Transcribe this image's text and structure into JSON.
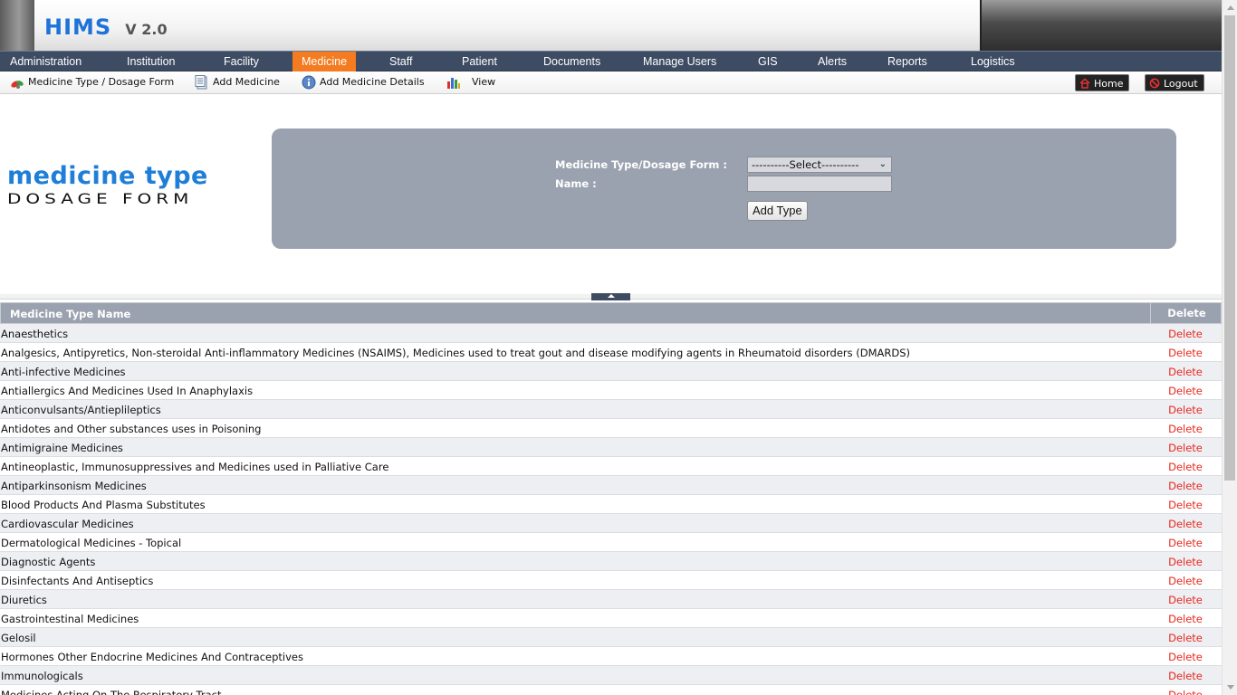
{
  "app": {
    "logo": "HIMS",
    "version": "V 2.0"
  },
  "top_nav": [
    {
      "label": "Administration",
      "active": false
    },
    {
      "label": "Institution",
      "active": false
    },
    {
      "label": "Facility",
      "active": false
    },
    {
      "label": "Medicine",
      "active": true
    },
    {
      "label": "Staff",
      "active": false
    },
    {
      "label": "Patient",
      "active": false
    },
    {
      "label": "Documents",
      "active": false
    },
    {
      "label": "Manage Users",
      "active": false
    },
    {
      "label": "GIS",
      "active": false
    },
    {
      "label": "Alerts",
      "active": false
    },
    {
      "label": "Reports",
      "active": false
    },
    {
      "label": "Logistics",
      "active": false
    }
  ],
  "sub_nav": [
    {
      "label": "Medicine Type / Dosage Form",
      "icon": "pills-icon"
    },
    {
      "label": "Add Medicine",
      "icon": "document-icon"
    },
    {
      "label": "Add Medicine Details",
      "icon": "info-icon"
    },
    {
      "label": "View",
      "icon": "bar-chart-icon"
    }
  ],
  "actions": {
    "home": "Home",
    "logout": "Logout"
  },
  "page_title": {
    "line1": "medicine type",
    "line2": "DOSAGE FORM"
  },
  "form": {
    "type_label": "Medicine Type/Dosage Form :",
    "type_selected": "----------Select----------",
    "name_label": "Name :",
    "name_value": "",
    "add_button": "Add Type"
  },
  "table": {
    "headers": {
      "name": "Medicine Type Name",
      "delete": "Delete"
    },
    "delete_label": "Delete",
    "rows": [
      "Anaesthetics",
      "Analgesics, Antipyretics, Non-steroidal Anti-inflammatory Medicines (NSAIMS), Medicines used to treat gout and disease modifying agents in Rheumatoid disorders (DMARDS)",
      "Anti-infective Medicines",
      "Antiallergics And Medicines Used In Anaphylaxis",
      "Anticonvulsants/Antieplileptics",
      "Antidotes and Other substances uses in Poisoning",
      "Antimigraine Medicines",
      "Antineoplastic, Immunosuppressives and Medicines used in Palliative Care",
      "Antiparkinsonism Medicines",
      "Blood Products And Plasma Substitutes",
      "Cardiovascular Medicines",
      "Dermatological Medicines - Topical",
      "Diagnostic Agents",
      "Disinfectants And Antiseptics",
      "Diuretics",
      "Gastrointestinal Medicines",
      "Gelosil",
      "Hormones Other Endocrine Medicines And Contraceptives",
      "Immunologicals",
      "Medicines Acting On The Respiratory Tract"
    ]
  },
  "colors": {
    "nav_bg": "#3d4c63",
    "active_tab": "#f47b20",
    "panel_bg": "#9aa1af",
    "delete_link": "#e8281e",
    "logo_blue": "#1e73d8"
  }
}
